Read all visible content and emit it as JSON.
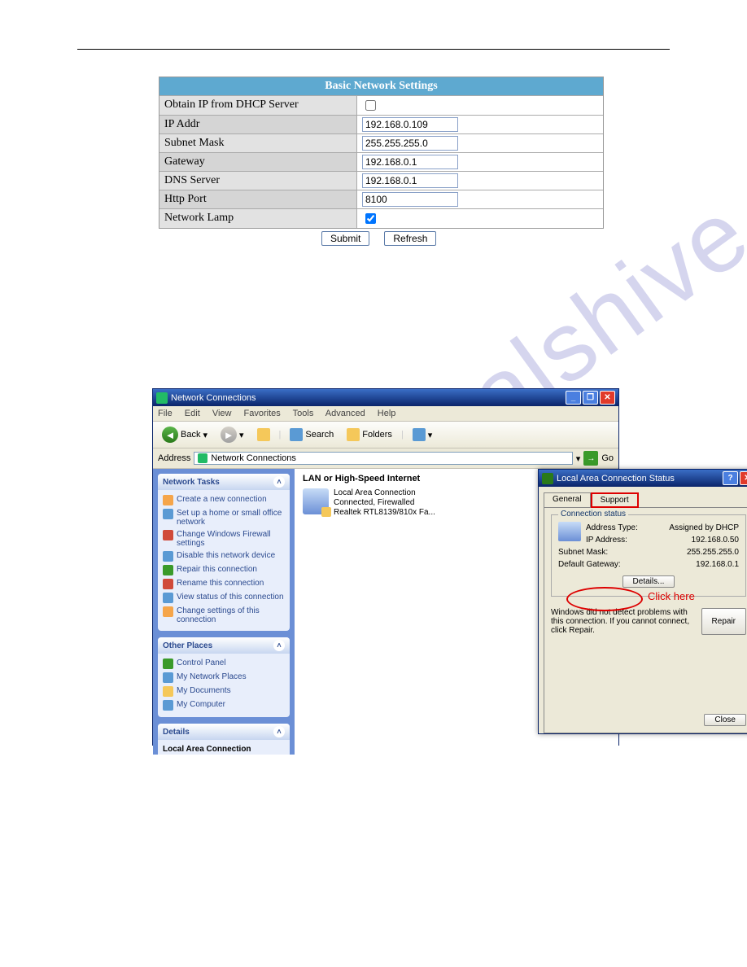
{
  "watermark": "manualshive.com",
  "bns": {
    "title": "Basic Network Settings",
    "rows": [
      {
        "label": "Obtain IP from DHCP Server",
        "value": ""
      },
      {
        "label": "IP Addr",
        "value": "192.168.0.109"
      },
      {
        "label": "Subnet Mask",
        "value": "255.255.255.0"
      },
      {
        "label": "Gateway",
        "value": "192.168.0.1"
      },
      {
        "label": "DNS Server",
        "value": "192.168.0.1"
      },
      {
        "label": "Http Port",
        "value": "8100"
      },
      {
        "label": "Network Lamp",
        "value": "checked"
      }
    ],
    "buttons": {
      "submit": "Submit",
      "refresh": "Refresh"
    }
  },
  "win": {
    "title": "Network Connections",
    "menu": [
      "File",
      "Edit",
      "View",
      "Favorites",
      "Tools",
      "Advanced",
      "Help"
    ],
    "toolbar": {
      "back": "Back",
      "search": "Search",
      "folders": "Folders"
    },
    "address": {
      "label": "Address",
      "value": "Network Connections",
      "go": "Go"
    },
    "sidebar": [
      {
        "title": "Network Tasks",
        "items": [
          "Create a new connection",
          "Set up a home or small office network",
          "Change Windows Firewall settings",
          "Disable this network device",
          "Repair this connection",
          "Rename this connection",
          "View status of this connection",
          "Change settings of this connection"
        ]
      },
      {
        "title": "Other Places",
        "items": [
          "Control Panel",
          "My Network Places",
          "My Documents",
          "My Computer"
        ]
      },
      {
        "title": "Details",
        "items": [
          "Local Area Connection"
        ]
      }
    ],
    "content": {
      "section": "LAN or High-Speed Internet",
      "item": {
        "name": "Local Area Connection",
        "state": "Connected, Firewalled",
        "device": "Realtek RTL8139/810x Fa..."
      }
    }
  },
  "dlg": {
    "title": "Local Area Connection Status",
    "tabs": [
      "General",
      "Support"
    ],
    "group": "Connection status",
    "rows": [
      {
        "k": "Address Type:",
        "v": "Assigned by DHCP"
      },
      {
        "k": "IP Address:",
        "v": "192.168.0.50"
      },
      {
        "k": "Subnet Mask:",
        "v": "255.255.255.0"
      },
      {
        "k": "Default Gateway:",
        "v": "192.168.0.1"
      }
    ],
    "details": "Details...",
    "clickhere": "Click here",
    "note": "Windows did not detect problems with this connection. If you cannot connect, click Repair.",
    "repair": "Repair",
    "close": "Close"
  }
}
